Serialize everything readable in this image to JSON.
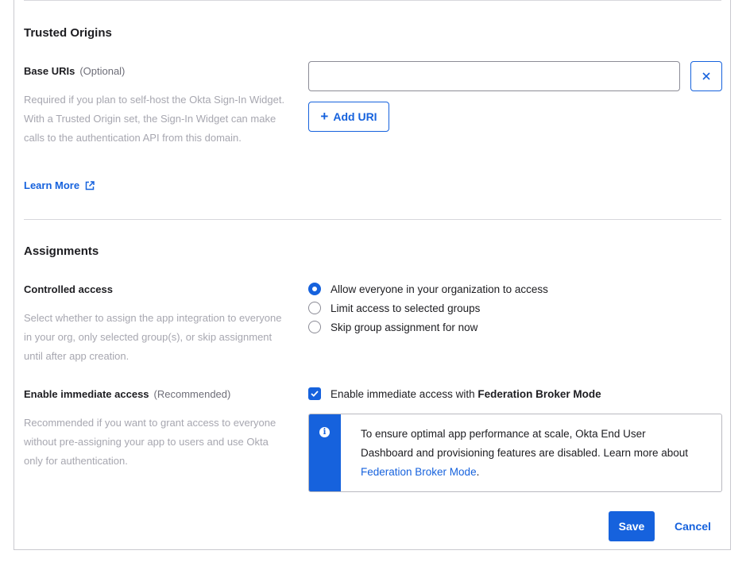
{
  "trusted_origins": {
    "title": "Trusted Origins",
    "base_uris_label": "Base URIs",
    "base_uris_optional": "(Optional)",
    "help": "Required if you plan to self-host the Okta Sign-In Widget. With a Trusted Origin set, the Sign-In Widget can make calls to the authentication API from this domain.",
    "learn_more": "Learn More",
    "learn_more_icon": "external-link-icon",
    "uri_value": "",
    "remove_icon": "close-icon",
    "add_uri_label": "Add URI",
    "add_icon": "plus-icon"
  },
  "assignments": {
    "title": "Assignments",
    "controlled_access_label": "Controlled access",
    "controlled_access_help": "Select whether to assign the app integration to everyone in your org, only selected group(s), or skip assignment until after app creation.",
    "options": [
      {
        "label": "Allow everyone in your organization to access",
        "checked": true
      },
      {
        "label": "Limit access to selected groups",
        "checked": false
      },
      {
        "label": "Skip group assignment for now",
        "checked": false
      }
    ],
    "immediate_access_label": "Enable immediate access",
    "immediate_access_optional": "(Recommended)",
    "immediate_access_help": "Recommended if you want to grant access to everyone without pre-assigning your app to users and use Okta only for authentication.",
    "checkbox_text": "Enable immediate access with ",
    "checkbox_bold": "Federation Broker Mode",
    "checkbox_checked": true,
    "callout_icon": "info-icon",
    "callout_text": "To ensure optimal app performance at scale, Okta End User Dashboard and provisioning features are disabled. Learn more about ",
    "callout_link": "Federation Broker Mode",
    "callout_end": "."
  },
  "actions": {
    "save": "Save",
    "cancel": "Cancel"
  },
  "colors": {
    "accent": "#1662dd",
    "muted_text": "#a7a7b0",
    "border": "#d7d7dc"
  }
}
